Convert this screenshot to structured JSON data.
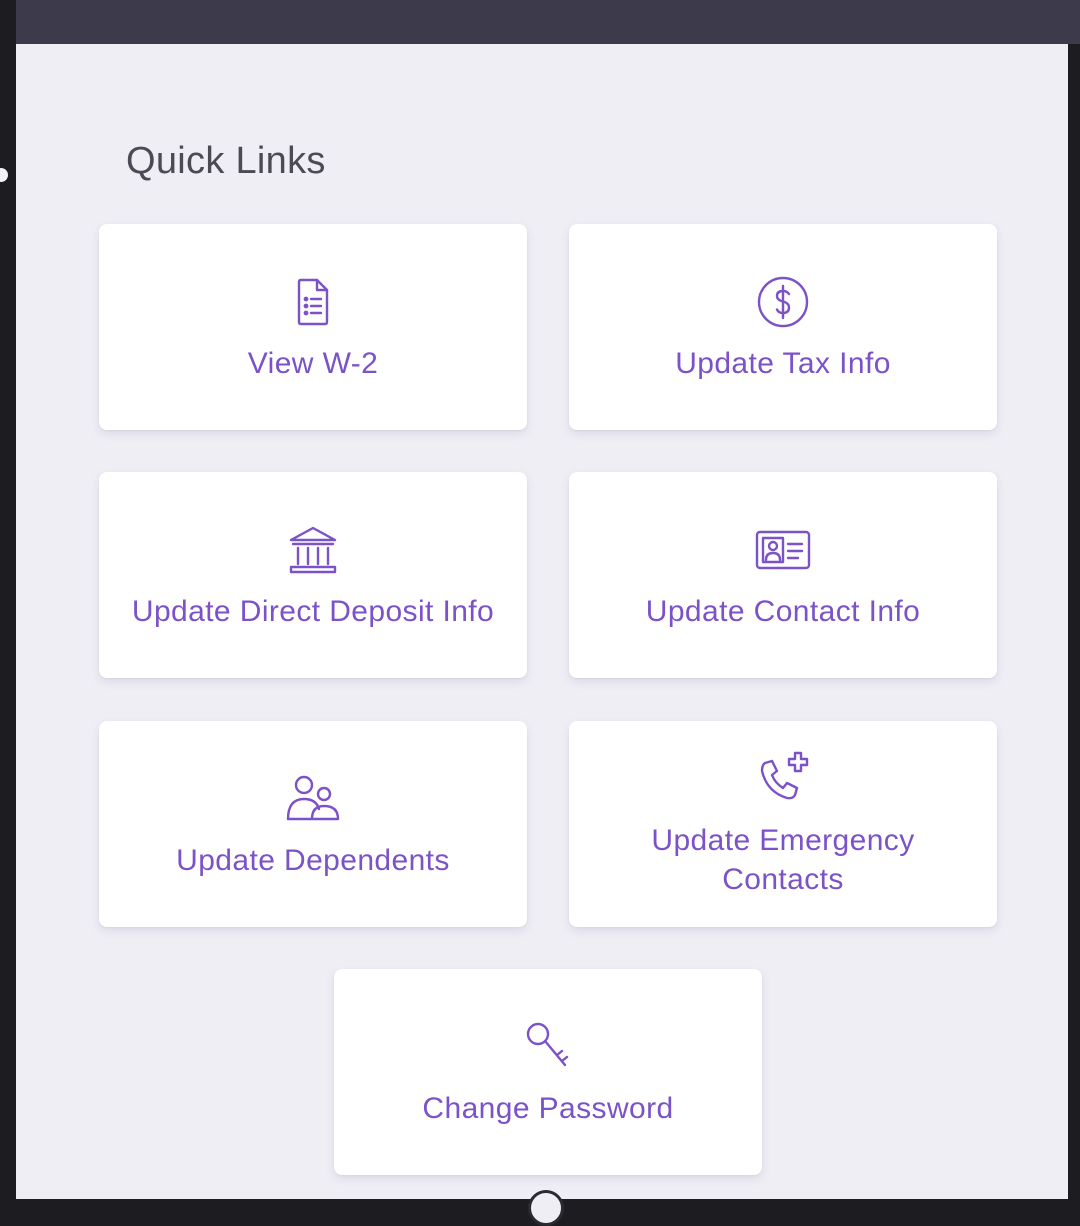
{
  "quick_links": {
    "title": "Quick Links",
    "items": [
      {
        "label": "View W-2",
        "icon": "document-list-icon"
      },
      {
        "label": "Update Tax Info",
        "icon": "dollar-circle-icon"
      },
      {
        "label": "Update Direct Deposit Info",
        "icon": "bank-icon"
      },
      {
        "label": "Update Contact Info",
        "icon": "contact-card-icon"
      },
      {
        "label": "Update Dependents",
        "icon": "people-icon"
      },
      {
        "label": "Update Emergency Contacts",
        "icon": "phone-plus-icon"
      },
      {
        "label": "Change Password",
        "icon": "key-icon"
      }
    ]
  },
  "colors": {
    "accent": "#7b52c8",
    "panel_background": "#efeef5",
    "card_background": "#ffffff",
    "top_bar": "#3d3a4c"
  }
}
